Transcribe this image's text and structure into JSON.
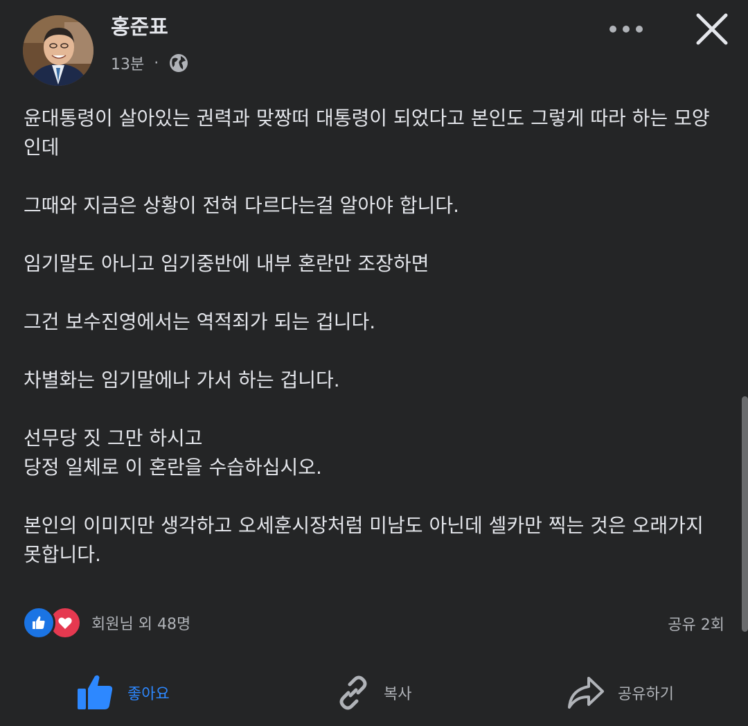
{
  "post": {
    "author_name": "홍준표",
    "time": "13분",
    "separator": "·",
    "privacy_icon": "globe-icon",
    "paragraphs": [
      "윤대통령이 살아있는 권력과 맞짱떠 대통령이 되었다고 본인도 그렇게 따라 하는 모양인데",
      "그때와 지금은 상황이 전혀 다르다는걸 알아야 합니다.",
      "임기말도 아니고 임기중반에 내부 혼란만 조장하면",
      "그건 보수진영에서는 역적죄가 되는 겁니다.",
      "차별화는 임기말에나 가서 하는 겁니다.",
      "선무당 짓 그만 하시고",
      "당정 일체로 이 혼란을 수습하십시오.",
      "본인의 이미지만 생각하고 오세훈시장처럼 미남도 아닌데 셀카만 찍는 것은 오래가지 못합니다."
    ]
  },
  "header": {
    "more_icon": "more-horizontal-icon",
    "close_icon": "close-icon"
  },
  "reactions": {
    "icons": [
      "like-icon",
      "love-icon"
    ],
    "summary": "회원님 외 48명",
    "shares": "공유 2회"
  },
  "actions": {
    "like_label": "좋아요",
    "copy_label": "복사",
    "share_label": "공유하기"
  },
  "colors": {
    "background": "#242526",
    "text": "#e4e6eb",
    "secondary_text": "#b0b3b8",
    "accent_blue": "#2d88ff",
    "like_blue": "#1b74e4",
    "love_red": "#e53950"
  }
}
